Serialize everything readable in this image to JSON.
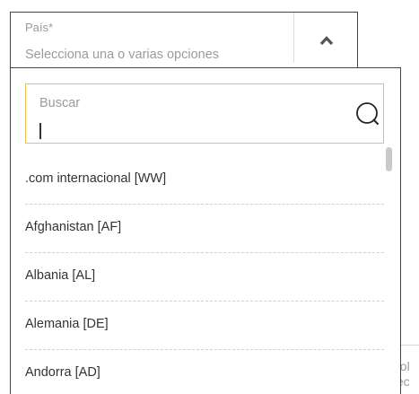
{
  "select": {
    "label": "País*",
    "hint": "Selecciona una o varias opciones",
    "chevron_icon": "chevron-up-icon"
  },
  "search": {
    "label": "Buscar",
    "value": "",
    "icon": "search-icon",
    "focus_color": "#f0c14b"
  },
  "options": [
    {
      "label": ".com internacional [WW]"
    },
    {
      "label": "Afghanistan [AF]"
    },
    {
      "label": "Albania [AL]"
    },
    {
      "label": "Alemania [DE]"
    },
    {
      "label": "Andorra [AD]"
    }
  ],
  "background": {
    "line1": "avol",
    "line2": "elec"
  }
}
